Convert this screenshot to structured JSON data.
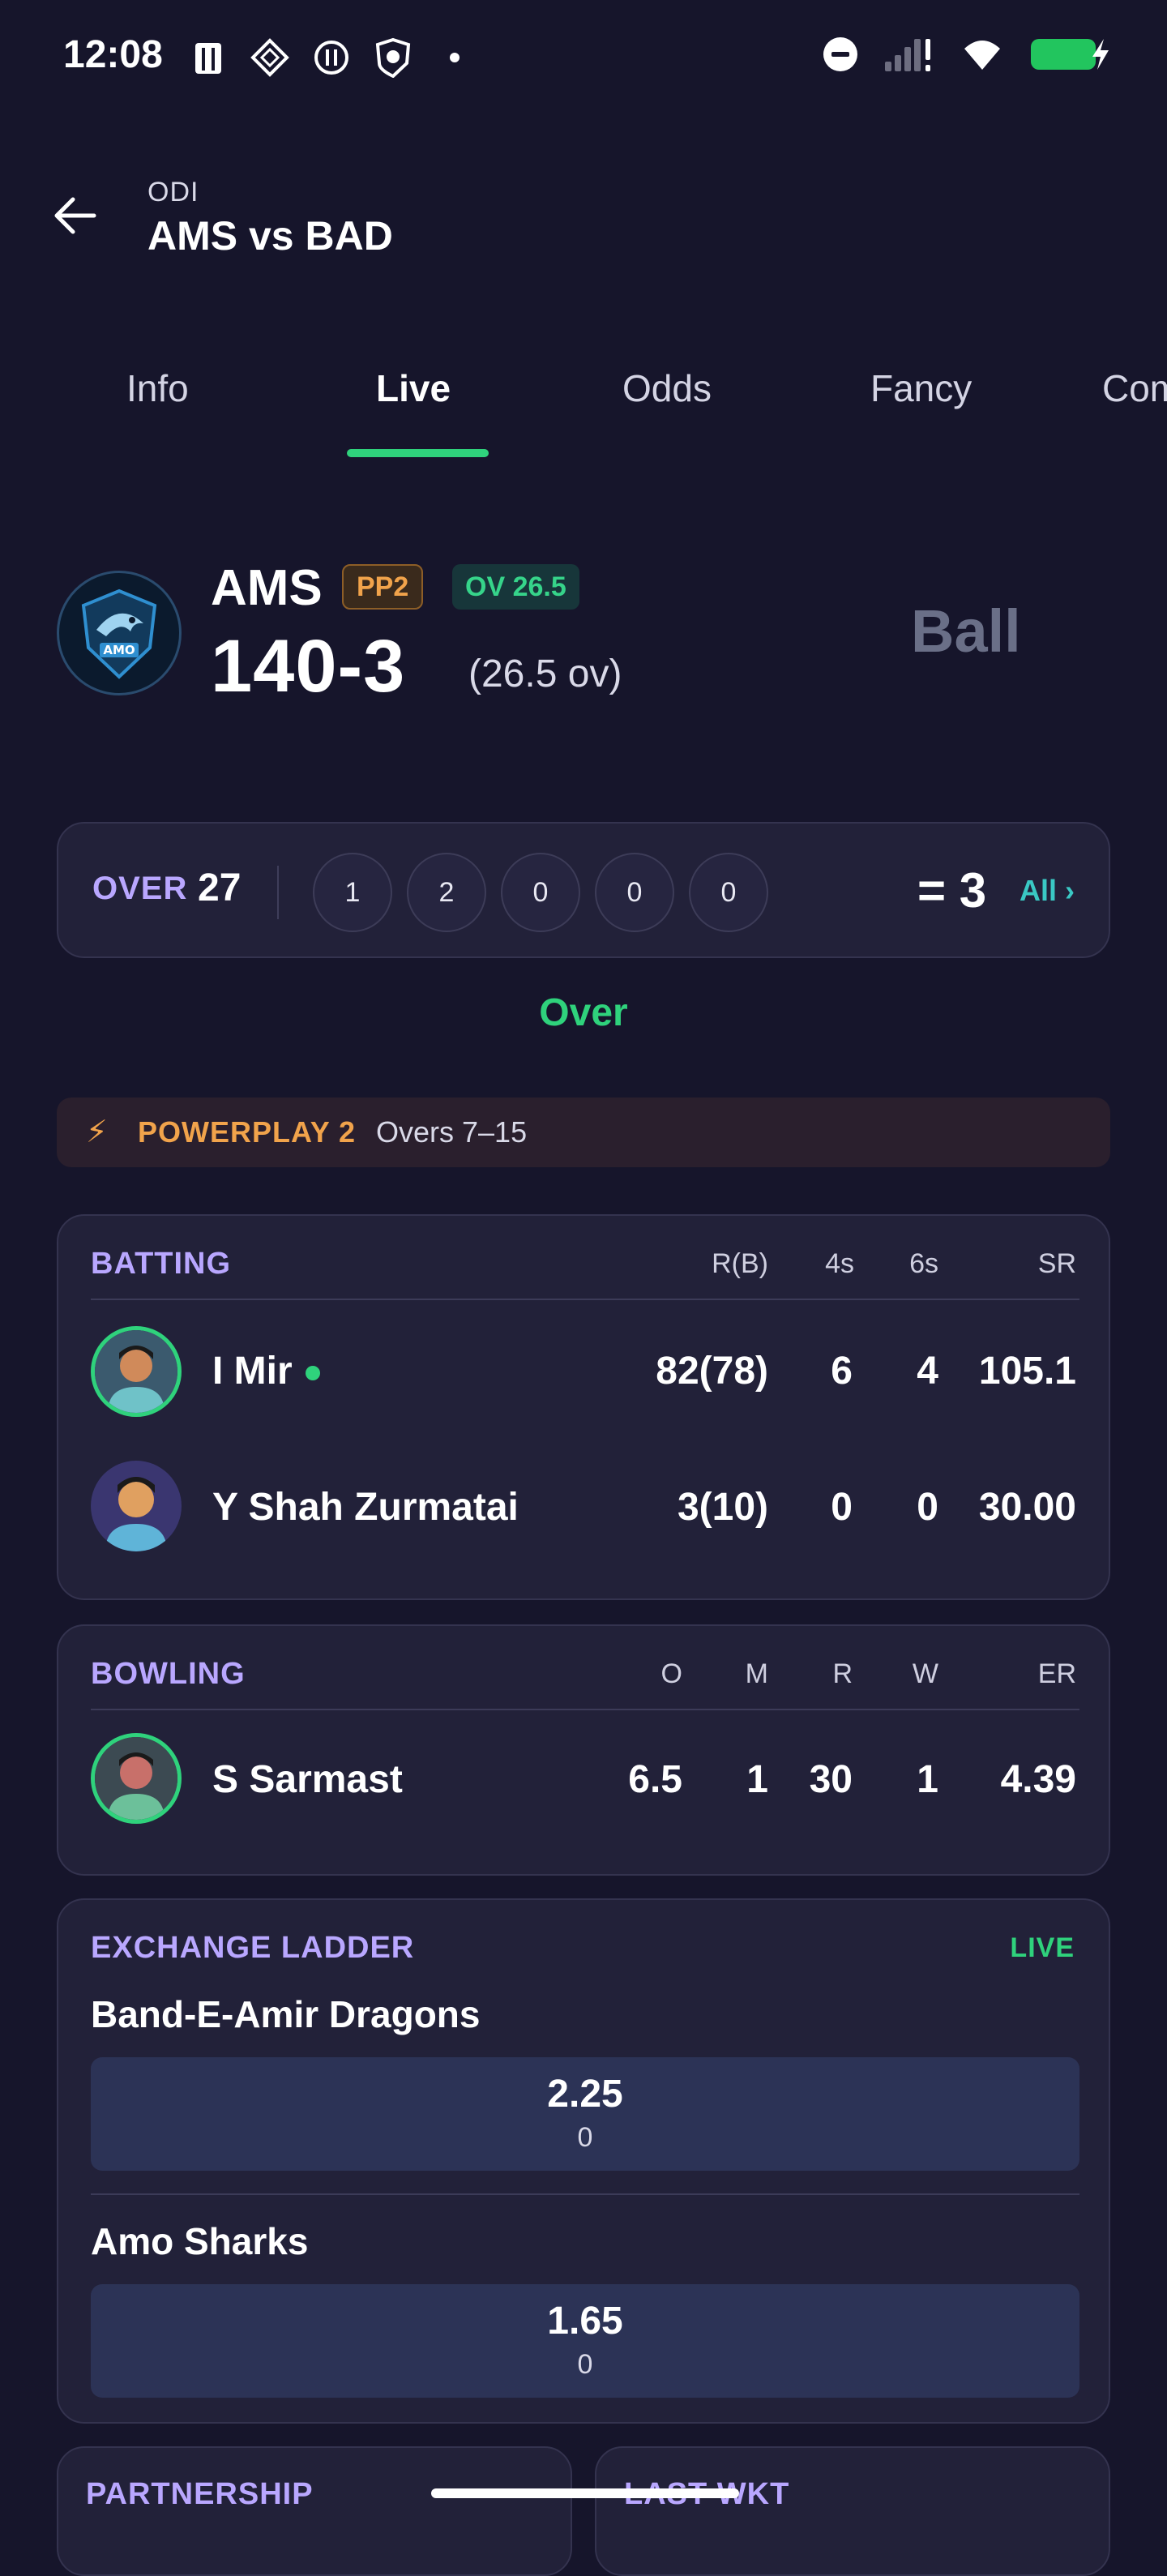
{
  "status_bar": {
    "time": "12:08",
    "left_icons": [
      "cricket-app-icon",
      "diamond-app-icon",
      "pause-app-icon",
      "shield-app-icon",
      "notification-dot-icon"
    ],
    "right_icons": [
      "do-not-disturb-icon",
      "signal-icon",
      "wifi-icon",
      "battery-charging-icon"
    ],
    "battery_color": "#22c55e"
  },
  "header": {
    "subtitle": "ODI",
    "title": "AMS vs BAD"
  },
  "tabs": [
    {
      "label": "Info",
      "active": false
    },
    {
      "label": "Live",
      "active": true
    },
    {
      "label": "Odds",
      "active": false
    },
    {
      "label": "Fancy",
      "active": false
    },
    {
      "label": "Com",
      "active": false
    }
  ],
  "score": {
    "team": "AMS",
    "pp_badge": "PP2",
    "ov_badge": "OV 26.5",
    "runs_wkts": "140-3",
    "overs": "(26.5 ov)",
    "ball_label": "Ball",
    "logo_text": "AMO"
  },
  "over": {
    "label": "OVER",
    "number": "27",
    "balls": [
      "1",
      "2",
      "0",
      "0",
      "0"
    ],
    "total": "= 3",
    "all_link": "All ›",
    "status": "Over"
  },
  "powerplay": {
    "icon": "lightning-icon",
    "title": "POWERPLAY 2",
    "overs": "Overs 7–15"
  },
  "batting": {
    "title": "BATTING",
    "columns": [
      "R(B)",
      "4s",
      "6s",
      "SR"
    ],
    "rows": [
      {
        "name": "I Mir",
        "on_strike": true,
        "rb": "82(78)",
        "fours": "6",
        "sixes": "4",
        "sr": "105.1"
      },
      {
        "name": "Y Shah Zurmatai",
        "on_strike": false,
        "rb": "3(10)",
        "fours": "0",
        "sixes": "0",
        "sr": "30.00"
      }
    ]
  },
  "bowling": {
    "title": "BOWLING",
    "columns": [
      "O",
      "M",
      "R",
      "W",
      "ER"
    ],
    "rows": [
      {
        "name": "S Sarmast",
        "o": "6.5",
        "m": "1",
        "r": "30",
        "w": "1",
        "er": "4.39"
      }
    ]
  },
  "exchange": {
    "title": "EXCHANGE LADDER",
    "live": "LIVE",
    "teams": [
      {
        "name": "Band-E-Amir Dragons",
        "odds": "2.25",
        "volume": "0"
      },
      {
        "name": "Amo Sharks",
        "odds": "1.65",
        "volume": "0"
      }
    ]
  },
  "bottom_cards": {
    "partnership": "PARTNERSHIP",
    "last_wkt": "LAST WKT"
  },
  "colors": {
    "background": "#16152b",
    "card": "#222139",
    "accent_green": "#2fd27c",
    "section_purple": "#b9a7ff",
    "orange": "#f1a34b",
    "teal": "#3ac8c4"
  }
}
